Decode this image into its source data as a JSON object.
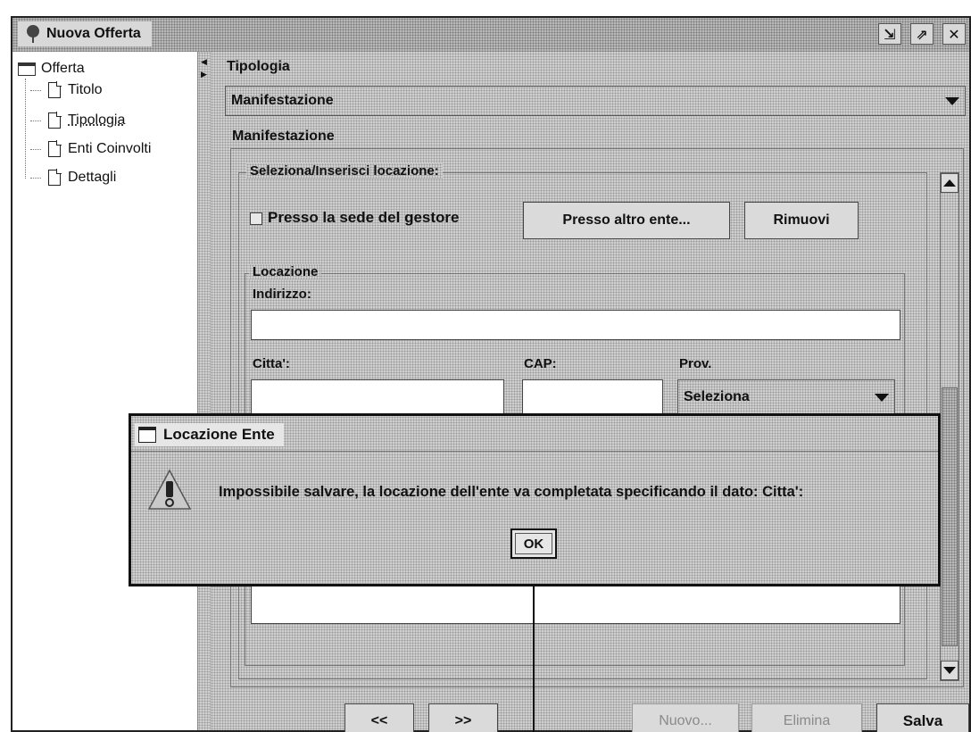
{
  "window": {
    "title": "Nuova Offerta",
    "controls": [
      "restore-icon",
      "maximize-icon",
      "close-icon"
    ]
  },
  "tree": {
    "root": "Offerta",
    "items": [
      {
        "label": "Titolo"
      },
      {
        "label": "Tipologia",
        "selected": true
      },
      {
        "label": "Enti Coinvolti"
      },
      {
        "label": "Dettagli"
      }
    ]
  },
  "main": {
    "tipologia_label": "Tipologia",
    "tipologia_value": "Manifestazione",
    "section_label": "Manifestazione",
    "location_group_title": "Seleziona/Inserisci locazione:",
    "checkbox_label": "Presso la sede del gestore",
    "btn_altro_ente": "Presso altro ente...",
    "btn_rimuovi": "Rimuovi",
    "locazione_title": "Locazione",
    "indirizzo_label": "Indirizzo:",
    "citta_label": "Citta':",
    "cap_label": "CAP:",
    "prov_label": "Prov.",
    "prov_value": "Seleziona"
  },
  "footer": {
    "prev": "<<",
    "next": ">>",
    "nuovo": "Nuovo...",
    "elimina": "Elimina",
    "salva": "Salva"
  },
  "dialog": {
    "title": "Locazione Ente",
    "message": "Impossibile salvare, la locazione dell'ente va completata specificando il dato: Citta':",
    "ok": "OK"
  }
}
